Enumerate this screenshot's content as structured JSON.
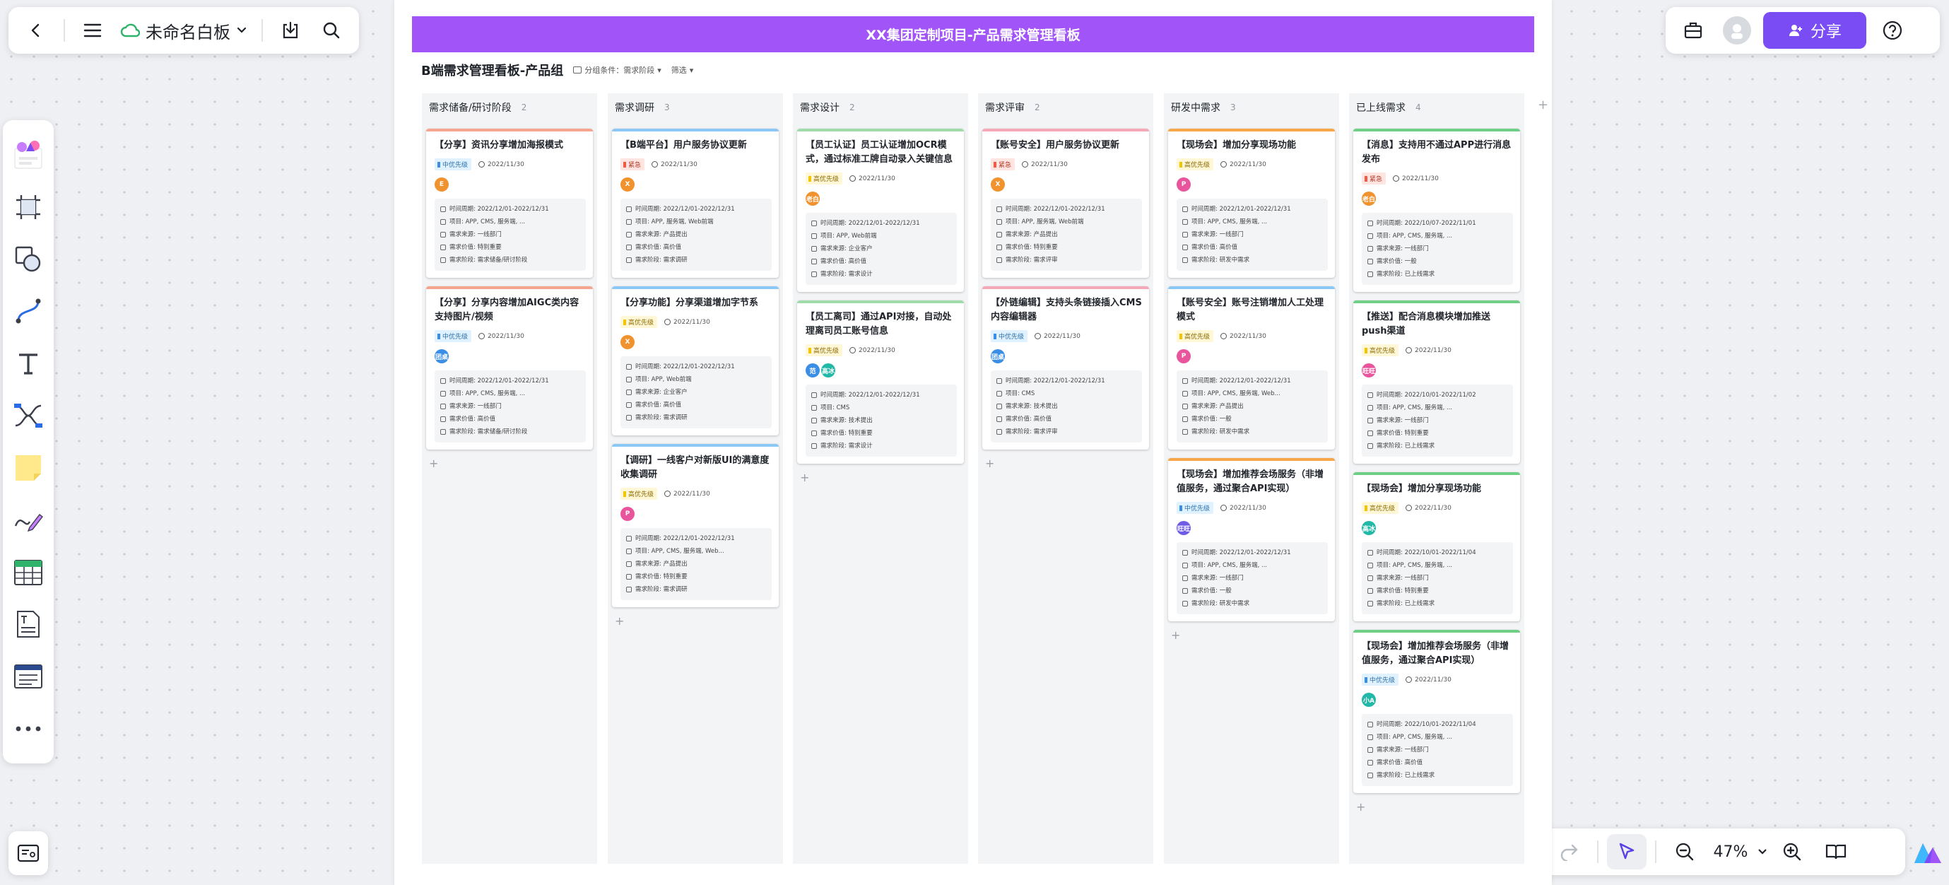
{
  "topbar": {
    "title": "未命名白板"
  },
  "topbar_right": {
    "share_label": "分享"
  },
  "zoom": {
    "level": "47%"
  },
  "board": {
    "title": "XX集团定制项目-产品需求管理看板",
    "subtitle": "B端需求管理看板-产品组",
    "group_chip": "分组条件：需求阶段",
    "filter_chip": "筛选"
  },
  "colors": {
    "accent": "#7a4cf3",
    "banner": "#a154f7",
    "tag_mid": "#e0f2ff",
    "tag_high": "#fff7d6",
    "tag_urgent": "#ffe4e0"
  },
  "columns": [
    {
      "name": "需求储备/研讨阶段",
      "count": "2",
      "cards": [
        {
          "title": "【分享】资讯分享增加海报模式",
          "tag": "中优先级",
          "tagType": "mid",
          "date": "2022/11/30",
          "avatars": [
            {
              "t": "E",
              "c": "#f0922e"
            }
          ],
          "border": "#f6a58e",
          "info": [
            "时间周期: 2022/12/01-2022/12/31",
            "项目: APP, CMS, 服务端, ...",
            "需求来源: 一线部门",
            "需求价值: 特别重要",
            "需求阶段: 需求储备/研讨阶段"
          ]
        },
        {
          "title": "【分享】分享内容增加AIGC类内容支持图片/视频",
          "tag": "中优先级",
          "tagType": "mid",
          "date": "2022/11/30",
          "avatars": [
            {
              "t": "团桌",
              "c": "#3a8ee6"
            }
          ],
          "border": "#f6a58e",
          "info": [
            "时间周期: 2022/12/01-2022/12/31",
            "项目: APP, CMS, 服务端, ...",
            "需求来源: 一线部门",
            "需求价值: 高价值",
            "需求阶段: 需求储备/研讨阶段"
          ]
        }
      ]
    },
    {
      "name": "需求调研",
      "count": "3",
      "cards": [
        {
          "title": "【B端平台】用户服务协议更新",
          "tag": "紧急",
          "tagType": "urgent",
          "date": "2022/11/30",
          "avatars": [
            {
              "t": "X",
              "c": "#f0922e"
            }
          ],
          "border": "#8cc8f5",
          "info": [
            "时间周期: 2022/12/01-2022/12/31",
            "项目: APP, 服务端, Web前端",
            "需求来源: 产品提出",
            "需求价值: 高价值",
            "需求阶段: 需求调研"
          ]
        },
        {
          "title": "【分享功能】分享渠道增加字节系",
          "tag": "高优先级",
          "tagType": "high",
          "date": "2022/11/30",
          "avatars": [
            {
              "t": "X",
              "c": "#f0922e"
            }
          ],
          "border": "#8cc8f5",
          "info": [
            "时间周期: 2022/12/01-2022/12/31",
            "项目: APP, Web前端",
            "需求来源: 企业客户",
            "需求价值: 高价值",
            "需求阶段: 需求调研"
          ]
        },
        {
          "title": "【调研】一线客户对新版UI的满意度收集调研",
          "tag": "高优先级",
          "tagType": "high",
          "date": "2022/11/30",
          "avatars": [
            {
              "t": "P",
              "c": "#e9559d"
            }
          ],
          "border": "#8cc8f5",
          "info": [
            "时间周期: 2022/12/01-2022/12/31",
            "项目: APP, CMS, 服务端, Web...",
            "需求来源: 产品提出",
            "需求价值: 特别重要",
            "需求阶段: 需求调研"
          ]
        }
      ]
    },
    {
      "name": "需求设计",
      "count": "2",
      "cards": [
        {
          "title": "【员工认证】员工认证增加OCR模式，通过标准工牌自动录入关键信息",
          "tag": "高优先级",
          "tagType": "high",
          "date": "2022/11/30",
          "avatars": [
            {
              "t": "老白",
              "c": "#f0922e"
            }
          ],
          "border": "#9fdcaa",
          "info": [
            "时间周期: 2022/12/01-2022/12/31",
            "项目: APP, Web前端",
            "需求来源: 企业客户",
            "需求价值: 高价值",
            "需求阶段: 需求设计"
          ]
        },
        {
          "title": "【员工离司】通过API对接，自动处理离司员工账号信息",
          "tag": "高优先级",
          "tagType": "high",
          "date": "2022/11/30",
          "avatars": [
            {
              "t": "范",
              "c": "#3a8ee6"
            },
            {
              "t": "高冰",
              "c": "#22b8a8"
            }
          ],
          "border": "#9fdcaa",
          "info": [
            "时间周期: 2022/12/01-2022/12/31",
            "项目: CMS",
            "需求来源: 技术提出",
            "需求价值: 特别重要",
            "需求阶段: 需求设计"
          ]
        }
      ]
    },
    {
      "name": "需求评审",
      "count": "2",
      "cards": [
        {
          "title": "【账号安全】用户服务协议更新",
          "tag": "紧急",
          "tagType": "urgent",
          "date": "2022/11/30",
          "avatars": [
            {
              "t": "X",
              "c": "#f0922e"
            }
          ],
          "border": "#f5a8b8",
          "info": [
            "时间周期: 2022/12/01-2022/12/31",
            "项目: APP, 服务端, Web前端",
            "需求来源: 产品提出",
            "需求价值: 特别重要",
            "需求阶段: 需求评审"
          ]
        },
        {
          "title": "【外链编辑】支持头条链接插入CMS内容编辑器",
          "tag": "中优先级",
          "tagType": "mid",
          "date": "2022/11/30",
          "avatars": [
            {
              "t": "团桌",
              "c": "#3a8ee6"
            }
          ],
          "border": "#f5a8b8",
          "info": [
            "时间周期: 2022/12/01-2022/12/31",
            "项目: CMS",
            "需求来源: 技术提出",
            "需求价值: 高价值",
            "需求阶段: 需求评审"
          ]
        }
      ]
    },
    {
      "name": "研发中需求",
      "count": "3",
      "cards": [
        {
          "title": "【现场会】增加分享现场功能",
          "tag": "高优先级",
          "tagType": "high",
          "date": "2022/11/30",
          "avatars": [
            {
              "t": "P",
              "c": "#e9559d"
            }
          ],
          "border": "#f7a64a",
          "info": [
            "时间周期: 2022/12/01-2022/12/31",
            "项目: APP, CMS, 服务端, ...",
            "需求来源: 一线部门",
            "需求价值: 高价值",
            "需求阶段: 研发中需求"
          ]
        },
        {
          "title": "【账号安全】账号注销增加人工处理模式",
          "tag": "高优先级",
          "tagType": "high",
          "date": "2022/11/30",
          "avatars": [
            {
              "t": "P",
              "c": "#e9559d"
            }
          ],
          "border": "#8cc8f5",
          "info": [
            "时间周期: 2022/12/01-2022/12/31",
            "项目: APP, CMS, 服务端, Web...",
            "需求来源: 产品提出",
            "需求价值: 一般",
            "需求阶段: 研发中需求"
          ]
        },
        {
          "title": "【现场会】增加推荐会场服务（非增值服务，通过聚合API实现）",
          "tag": "中优先级",
          "tagType": "mid",
          "date": "2022/11/30",
          "avatars": [
            {
              "t": "旺旺",
              "c": "#6e5ce6"
            }
          ],
          "border": "#f7a64a",
          "info": [
            "时间周期: 2022/12/01-2022/12/31",
            "项目: APP, CMS, 服务端, ...",
            "需求来源: 一线部门",
            "需求价值: 一般",
            "需求阶段: 研发中需求"
          ]
        }
      ]
    },
    {
      "name": "已上线需求",
      "count": "4",
      "cards": [
        {
          "title": "【消息】支持用不通过APP进行消息发布",
          "tag": "紧急",
          "tagType": "urgent",
          "date": "2022/11/30",
          "avatars": [
            {
              "t": "老白",
              "c": "#f0922e"
            }
          ],
          "border": "#6fcf87",
          "info": [
            "时间周期: 2022/10/07-2022/11/01",
            "项目: APP, CMS, 服务端, ...",
            "需求来源: 一线部门",
            "需求价值: 一般",
            "需求阶段: 已上线需求"
          ]
        },
        {
          "title": "【推送】配合消息模块增加推送push渠道",
          "tag": "高优先级",
          "tagType": "high",
          "date": "2022/11/30",
          "avatars": [
            {
              "t": "旺旺",
              "c": "#e9559d"
            }
          ],
          "border": "#6fcf87",
          "info": [
            "时间周期: 2022/10/01-2022/11/02",
            "项目: APP, CMS, 服务端, ...",
            "需求来源: 一线部门",
            "需求价值: 特别重要",
            "需求阶段: 已上线需求"
          ]
        },
        {
          "title": "【现场会】增加分享现场功能",
          "tag": "高优先级",
          "tagType": "high",
          "date": "2022/11/30",
          "avatars": [
            {
              "t": "高冰",
              "c": "#22b8a8"
            }
          ],
          "border": "#6fcf87",
          "info": [
            "时间周期: 2022/10/01-2022/11/04",
            "项目: APP, CMS, 服务端, ...",
            "需求来源: 一线部门",
            "需求价值: 特别重要",
            "需求阶段: 已上线需求"
          ]
        },
        {
          "title": "【现场会】增加推荐会场服务（非增值服务，通过聚合API实现）",
          "tag": "中优先级",
          "tagType": "mid",
          "date": "2022/11/30",
          "avatars": [
            {
              "t": "小A",
              "c": "#22b8a8"
            }
          ],
          "border": "#6fcf87",
          "info": [
            "时间周期: 2022/10/01-2022/11/04",
            "项目: APP, CMS, 服务端, ...",
            "需求来源: 一线部门",
            "需求价值: 高价值",
            "需求阶段: 已上线需求"
          ]
        }
      ]
    }
  ]
}
